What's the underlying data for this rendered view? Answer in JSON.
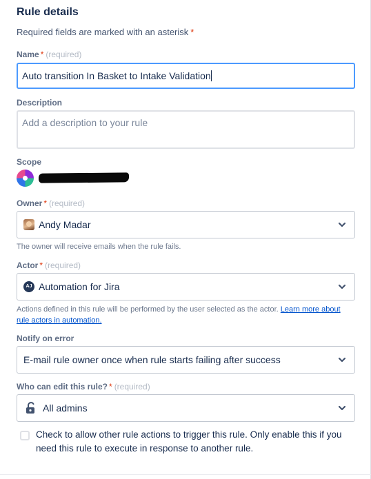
{
  "section": {
    "title": "Rule details",
    "required_note": "Required fields are marked with an asterisk",
    "asterisk": "*"
  },
  "name": {
    "label": "Name",
    "required_text": "(required)",
    "value": "Auto transition In Basket to Intake Validation"
  },
  "description": {
    "label": "Description",
    "placeholder": "Add a description to your rule"
  },
  "scope": {
    "label": "Scope",
    "icon": "project-avatar-icon"
  },
  "owner": {
    "label": "Owner",
    "required_text": "(required)",
    "value": "Andy Madar",
    "help": "The owner will receive emails when the rule fails."
  },
  "actor": {
    "label": "Actor",
    "required_text": "(required)",
    "avatar_initials": "AJ",
    "value": "Automation for Jira",
    "help": "Actions defined in this rule will be performed by the user selected as the actor.",
    "help_link": "Learn more about rule actors in automation."
  },
  "notify": {
    "label": "Notify on error",
    "value": "E-mail rule owner once when rule starts failing after success"
  },
  "editors": {
    "label": "Who can edit this rule?",
    "required_text": "(required)",
    "value": "All admins"
  },
  "trigger_checkbox": {
    "checked": false,
    "label": "Check to allow other rule actions to trigger this rule. Only enable this if you need this rule to execute in response to another rule."
  },
  "colors": {
    "focus_border": "#4c9aff",
    "required_asterisk": "#de350b",
    "link": "#0052cc"
  }
}
